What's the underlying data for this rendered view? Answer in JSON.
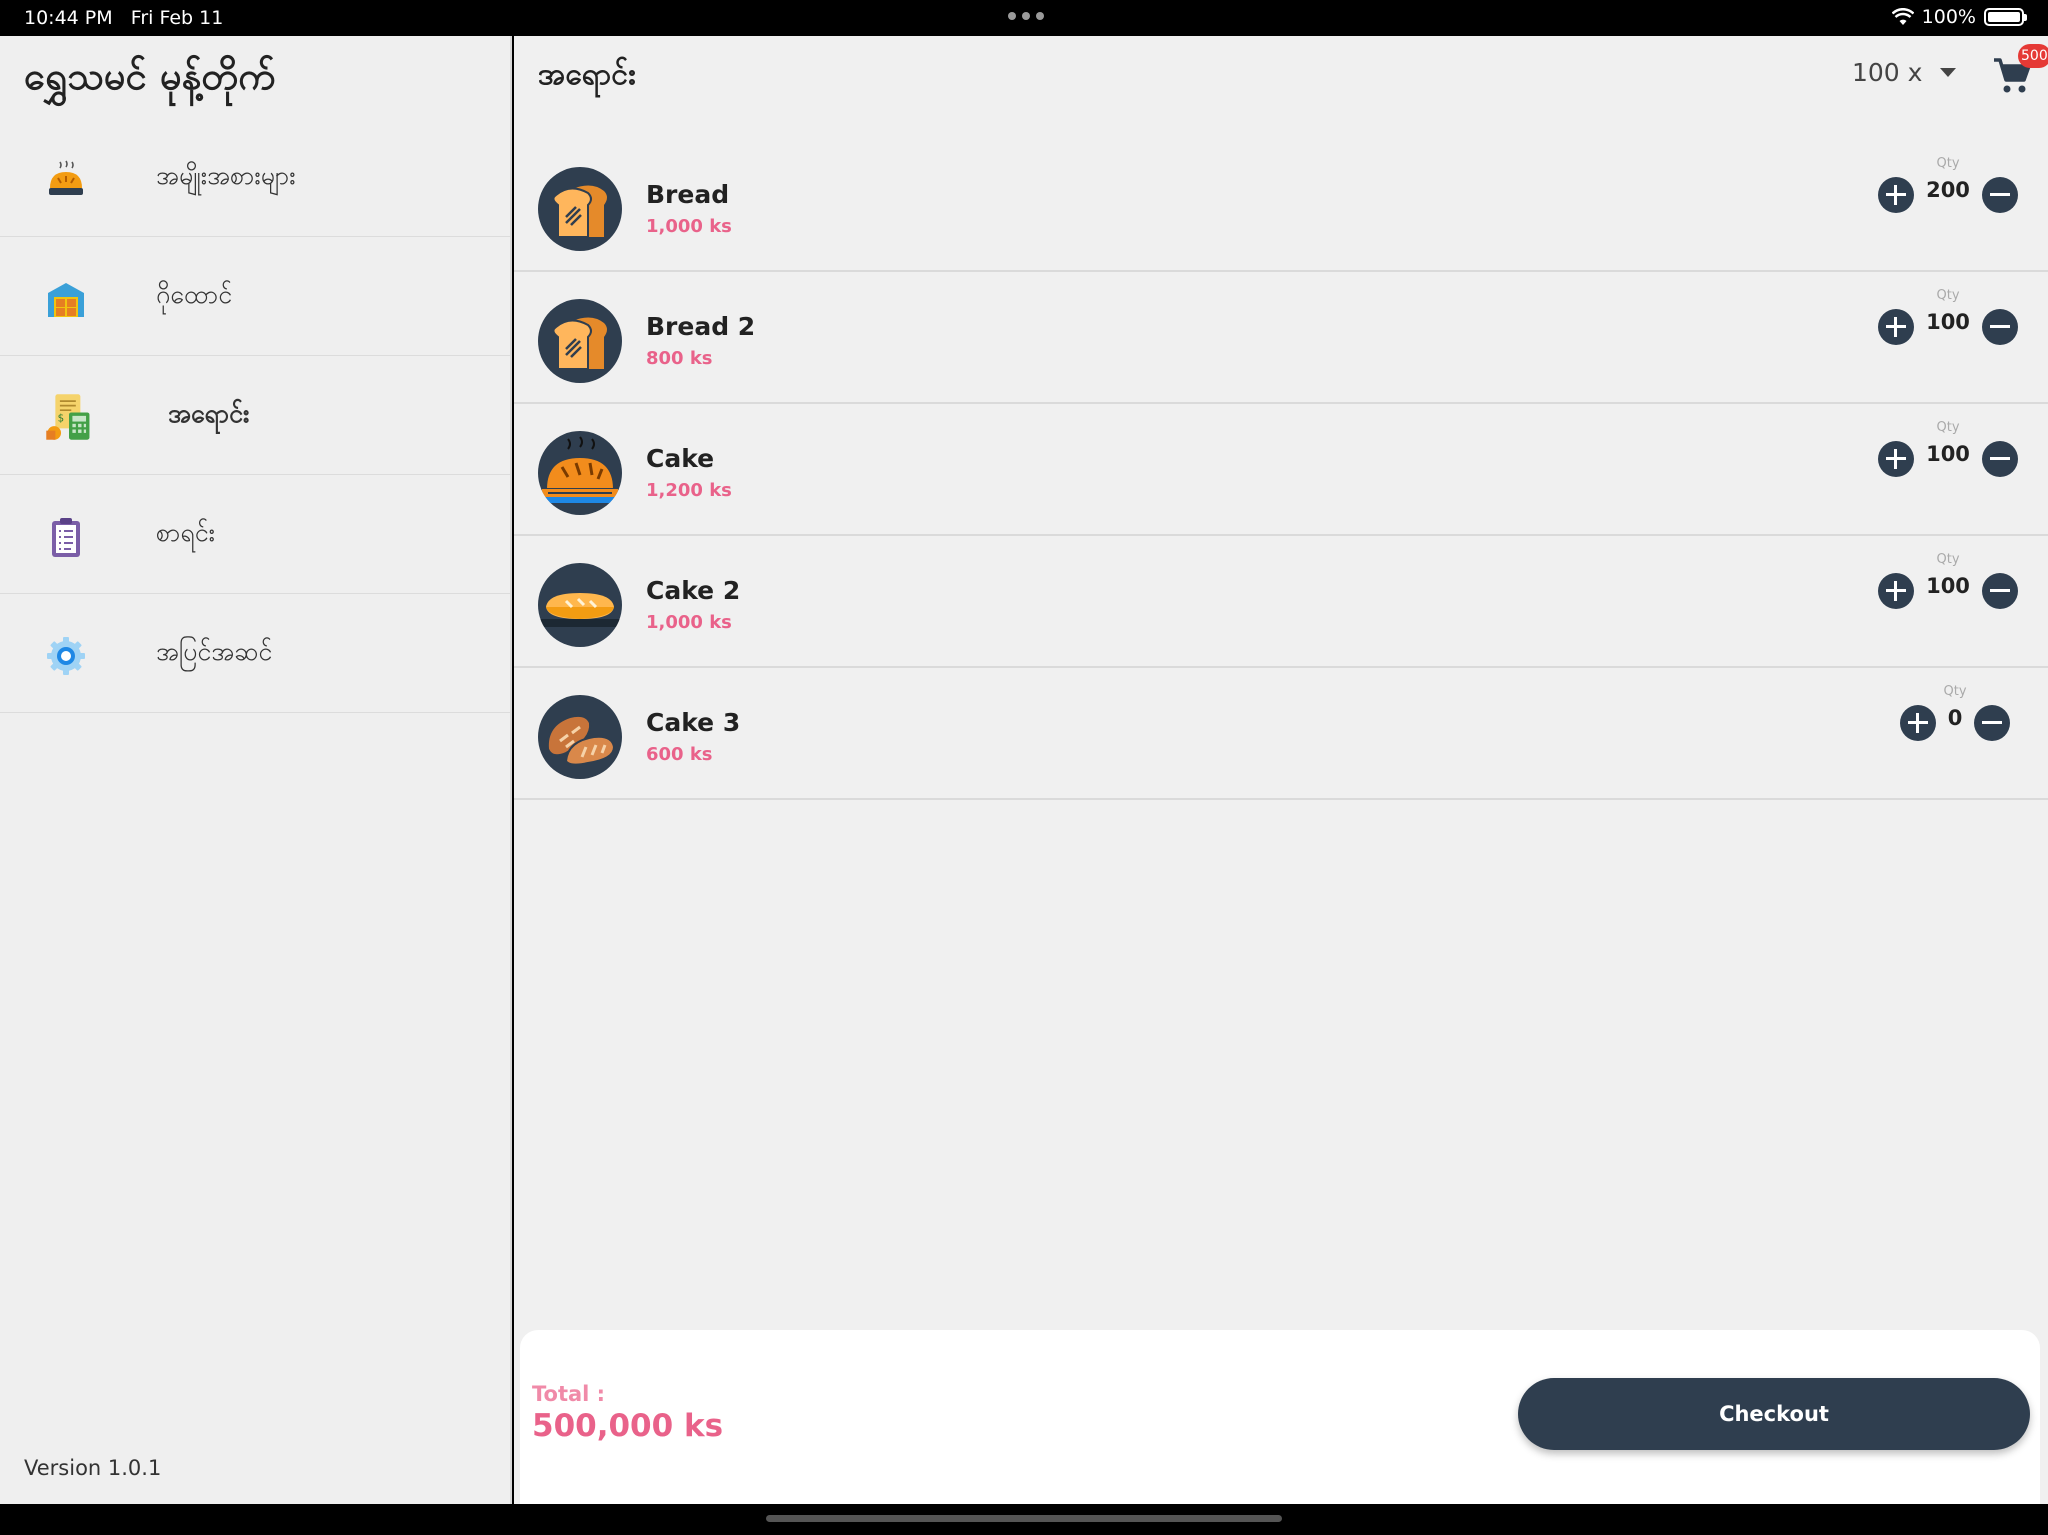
{
  "status_bar": {
    "time": "10:44 PM",
    "date": "Fri Feb 11",
    "battery": "100%"
  },
  "sidebar": {
    "title": "ရွှေသမင် မုန့်တိုက်",
    "items": [
      {
        "label": "အမျိုးအစားများ",
        "icon": "bakery-icon",
        "active": false
      },
      {
        "label": "ဂိုထောင်",
        "icon": "warehouse-icon",
        "active": false
      },
      {
        "label": "အရောင်း",
        "icon": "sales-calculator-icon",
        "active": true
      },
      {
        "label": "စာရင်း",
        "icon": "clipboard-icon",
        "active": false
      },
      {
        "label": "အပြင်အဆင်",
        "icon": "settings-gear-icon",
        "active": false
      }
    ],
    "version": "Version 1.0.1"
  },
  "main": {
    "title": "အရောင်း",
    "multiplier": "100 x",
    "cart_badge": "500",
    "qty_label": "Qty",
    "products": [
      {
        "name": "Bread",
        "price": "1,000 ks",
        "qty": "200",
        "icon": "toast-bread-icon"
      },
      {
        "name": "Bread 2",
        "price": "800 ks",
        "qty": "100",
        "icon": "toast-bread-icon"
      },
      {
        "name": "Cake",
        "price": "1,200 ks",
        "qty": "100",
        "icon": "baked-loaf-icon"
      },
      {
        "name": "Cake 2",
        "price": "1,000 ks",
        "qty": "100",
        "icon": "baguette-icon"
      },
      {
        "name": "Cake 3",
        "price": "600 ks",
        "qty": "0",
        "icon": "bread-rolls-icon"
      }
    ]
  },
  "footer": {
    "total_label": "Total :",
    "total_value": "500,000 ks",
    "checkout_label": "Checkout"
  },
  "colors": {
    "accent_dark": "#2f3e4f",
    "price_pink": "#e9628a",
    "badge_red": "#e53935"
  }
}
